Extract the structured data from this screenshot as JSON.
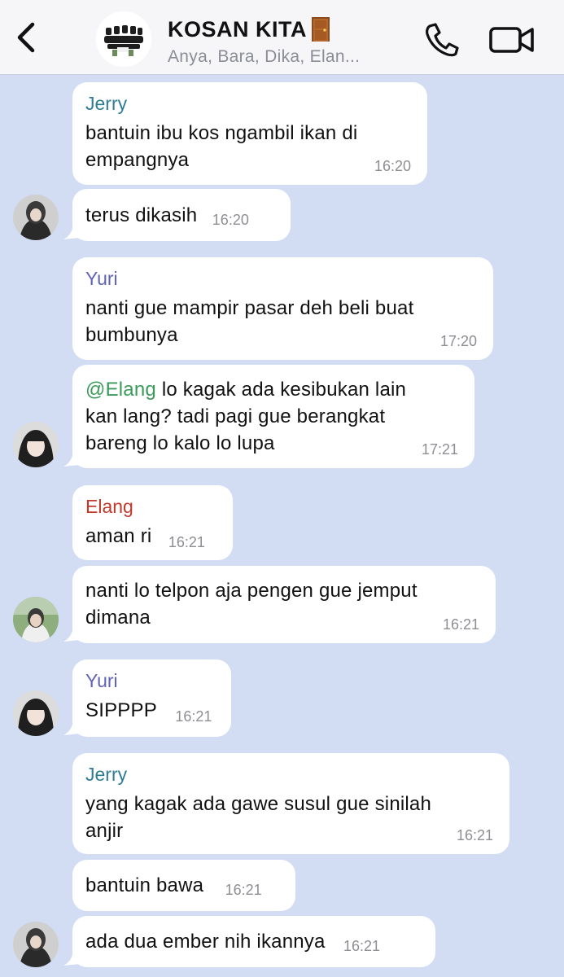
{
  "header": {
    "title": "KOSAN KITA",
    "members": "Anya, Bara, Dika, Elan...",
    "back_icon": "chevron-left-icon",
    "call_icon": "phone-icon",
    "video_icon": "video-camera-icon",
    "door_icon": "door-emoji"
  },
  "colors": {
    "background": "#d2ddf3",
    "bubble": "#ffffff",
    "jerry": "#2f7d95",
    "yuri": "#5f63b8",
    "elang": "#c0392b",
    "mention": "#3a9a5a",
    "timestamp": "#8e8e93"
  },
  "messages": [
    {
      "sender": "Jerry",
      "lines": [
        "bantuin ibu kos ngambil ikan di",
        "empangnya"
      ],
      "time": "16:20"
    },
    {
      "sender": "",
      "lines": [
        "terus dikasih"
      ],
      "time": "16:20"
    },
    {
      "sender": "Yuri",
      "lines": [
        "nanti gue mampir pasar deh beli buat",
        "bumbunya"
      ],
      "time": "17:20"
    },
    {
      "sender": "",
      "mention": "@Elang",
      "lines": [
        " lo kagak ada kesibukan lain",
        "kan lang? tadi pagi gue berangkat",
        "bareng lo kalo lo lupa"
      ],
      "time": "17:21"
    },
    {
      "sender": "Elang",
      "lines": [
        "aman ri"
      ],
      "time": "16:21"
    },
    {
      "sender": "",
      "lines": [
        "nanti lo telpon aja pengen gue jemput",
        "dimana"
      ],
      "time": "16:21"
    },
    {
      "sender": "Yuri",
      "lines": [
        "SIPPPP"
      ],
      "time": "16:21"
    },
    {
      "sender": "Jerry",
      "lines": [
        "yang kagak ada gawe susul gue sinilah",
        "anjir"
      ],
      "time": "16:21"
    },
    {
      "sender": "",
      "lines": [
        "bantuin bawa"
      ],
      "time": "16:21"
    },
    {
      "sender": "",
      "lines": [
        "ada dua ember nih ikannya"
      ],
      "time": "16:21"
    }
  ]
}
